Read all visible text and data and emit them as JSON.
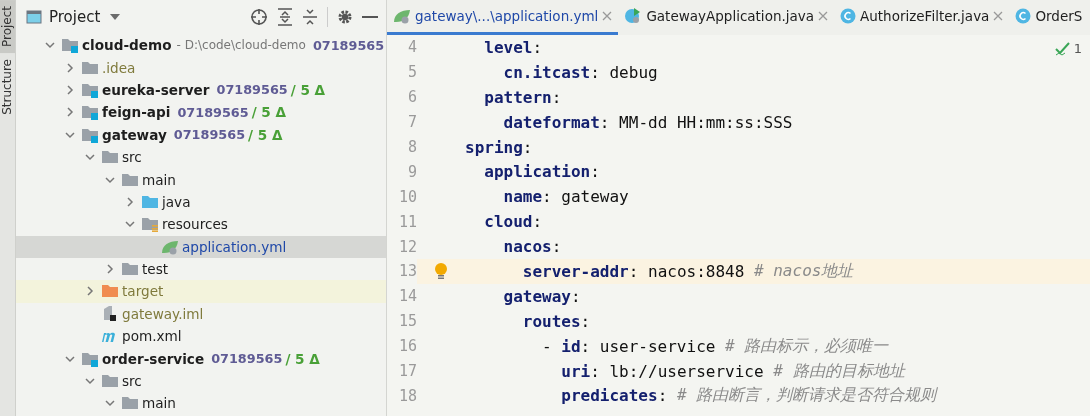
{
  "tool_strip": [
    {
      "label": "Project",
      "selected": true
    },
    {
      "label": "Structure",
      "selected": false
    }
  ],
  "project_panel": {
    "title": "Project",
    "tree": [
      {
        "name": "cloud-demo",
        "kind": "module",
        "expanded": true,
        "selected": false,
        "location": "- D:\\code\\cloud-demo",
        "revision": "07189565",
        "children": [
          {
            "name": ".idea",
            "kind": "folder",
            "expanded": false,
            "selected": false,
            "vcs_ignored": true
          },
          {
            "name": "eureka-server",
            "kind": "module",
            "expanded": false,
            "selected": false,
            "revision": "07189565",
            "changes": "/ 5 Δ"
          },
          {
            "name": "feign-api",
            "kind": "module",
            "expanded": false,
            "selected": false,
            "revision": "07189565",
            "changes": "/ 5 Δ"
          },
          {
            "name": "gateway",
            "kind": "module",
            "expanded": true,
            "selected": false,
            "revision": "07189565",
            "changes": "/ 5 Δ",
            "children": [
              {
                "name": "src",
                "kind": "folder",
                "expanded": true,
                "selected": false,
                "children": [
                  {
                    "name": "main",
                    "kind": "folder",
                    "expanded": true,
                    "selected": false,
                    "children": [
                      {
                        "name": "java",
                        "kind": "source",
                        "expanded": false,
                        "selected": false
                      },
                      {
                        "name": "resources",
                        "kind": "resources",
                        "expanded": true,
                        "selected": false,
                        "children": [
                          {
                            "name": "application.yml",
                            "kind": "yaml",
                            "selected": true,
                            "vcs_modified": true
                          }
                        ]
                      }
                    ]
                  },
                  {
                    "name": "test",
                    "kind": "folder",
                    "expanded": false,
                    "selected": false
                  }
                ]
              },
              {
                "name": "target",
                "kind": "excluded",
                "expanded": false,
                "selected": false,
                "vcs_ignored": true,
                "highlighted": true
              },
              {
                "name": "gateway.iml",
                "kind": "iml",
                "selected": false,
                "vcs_ignored": true
              },
              {
                "name": "pom.xml",
                "kind": "maven",
                "selected": false
              }
            ]
          },
          {
            "name": "order-service",
            "kind": "module",
            "expanded": true,
            "selected": false,
            "revision": "07189565",
            "changes": "/ 5 Δ",
            "children": [
              {
                "name": "src",
                "kind": "folder",
                "expanded": true,
                "selected": false,
                "children": [
                  {
                    "name": "main",
                    "kind": "folder",
                    "expanded": true,
                    "selected": false
                  }
                ]
              }
            ]
          }
        ]
      }
    ]
  },
  "editor": {
    "tabs": [
      {
        "label": "gateway\\...\\application.yml",
        "kind": "yaml",
        "selected": true,
        "closable": true
      },
      {
        "label": "GatewayApplication.java",
        "kind": "boot",
        "selected": false,
        "closable": true
      },
      {
        "label": "AuthorizeFilter.java",
        "kind": "class",
        "selected": false,
        "closable": true
      },
      {
        "label": "OrderS",
        "kind": "class",
        "selected": false,
        "closable": false
      }
    ],
    "inspection_count": "1",
    "lines": [
      {
        "kind": "continuation",
        "children": [
          {
            "kind": "entry",
            "number": "4",
            "current": false,
            "key": "level",
            "rest": ":",
            "children": [
              {
                "kind": "entry",
                "number": "5",
                "current": false,
                "key": "cn.itcast",
                "rest": ": debug"
              }
            ]
          },
          {
            "kind": "entry",
            "number": "6",
            "current": false,
            "key": "pattern",
            "rest": ":",
            "children": [
              {
                "kind": "entry",
                "number": "7",
                "current": false,
                "key": "dateformat",
                "rest": ": MM-dd HH:mm:ss:SSS"
              }
            ]
          }
        ]
      },
      {
        "kind": "entry",
        "number": "8",
        "current": false,
        "key": "spring",
        "rest": ":",
        "children": [
          {
            "kind": "entry",
            "number": "9",
            "current": false,
            "key": "application",
            "rest": ":",
            "children": [
              {
                "kind": "entry",
                "number": "10",
                "current": false,
                "key": "name",
                "rest": ": gateway"
              }
            ]
          },
          {
            "kind": "entry",
            "number": "11",
            "current": false,
            "key": "cloud",
            "rest": ":",
            "children": [
              {
                "kind": "entry",
                "number": "12",
                "current": false,
                "key": "nacos",
                "rest": ":",
                "children": [
                  {
                    "kind": "entry",
                    "number": "13",
                    "current": true,
                    "key": "server-addr",
                    "rest": ": nacos:8848 ",
                    "comment": "# nacos地址"
                  }
                ]
              },
              {
                "kind": "entry",
                "number": "14",
                "current": false,
                "key": "gateway",
                "rest": ":",
                "children": [
                  {
                    "kind": "entry",
                    "number": "15",
                    "current": false,
                    "key": "routes",
                    "rest": ":",
                    "children": [
                      {
                        "kind": "entry",
                        "number": "16",
                        "current": false,
                        "bullet": "-",
                        "key": "id",
                        "rest": ": user-service ",
                        "comment": "# 路由标示，必须唯一",
                        "children": [
                          {
                            "kind": "entry",
                            "number": "17",
                            "current": false,
                            "key": "uri",
                            "rest": ": lb://userservice ",
                            "comment": "# 路由的目标地址"
                          },
                          {
                            "kind": "entry",
                            "number": "18",
                            "current": false,
                            "key": "predicates",
                            "rest": ": ",
                            "comment": "# 路由断言，判断请求是否符合规则"
                          }
                        ]
                      }
                    ]
                  }
                ]
              }
            ]
          }
        ]
      }
    ]
  }
}
